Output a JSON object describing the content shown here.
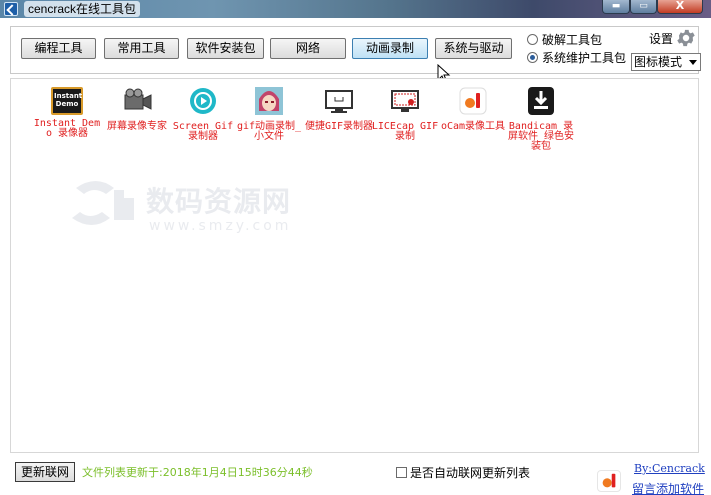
{
  "window": {
    "title": "cencrack在线工具包",
    "close_glyph": "X"
  },
  "categories": [
    {
      "label": "编程工具"
    },
    {
      "label": "常用工具"
    },
    {
      "label": "软件安装包"
    },
    {
      "label": "网络"
    },
    {
      "label": "动画录制",
      "active": true
    },
    {
      "label": "系统与驱动"
    }
  ],
  "toolkit_options": [
    {
      "label": "破解工具包",
      "checked": false
    },
    {
      "label": "系统维护工具包",
      "checked": true
    }
  ],
  "settings": {
    "label": "设置",
    "view_mode": "图标模式"
  },
  "tools": [
    {
      "label": "Instant Demo 录像器",
      "icon": "instant-demo-icon",
      "badge": "Instant Demo"
    },
    {
      "label": "屏幕录像专家",
      "icon": "video-camera-icon"
    },
    {
      "label": "Screen Gif 录制器",
      "icon": "play-circle-icon"
    },
    {
      "label": "gif动画录制_小文件",
      "icon": "anime-character-icon"
    },
    {
      "label": "便捷GIF录制器",
      "icon": "monitor-icon"
    },
    {
      "label": "LICEcap GIF 录制",
      "icon": "record-monitor-icon"
    },
    {
      "label": "oCam录像工具",
      "icon": "ocam-icon"
    },
    {
      "label": "Bandicam 录屏软件_绿色安装包",
      "icon": "download-icon"
    }
  ],
  "watermark": {
    "text": "数码资源网",
    "url": "www.smzy.com"
  },
  "status": {
    "refresh_button": "更新联网",
    "update_text": "文件列表更新于:2018年1月4日15时36分44秒",
    "auto_update_label": "是否自动联网更新列表",
    "auto_update_checked": false,
    "author_link": "By:Cencrack",
    "feedback_link": "留言添加软件"
  },
  "colors": {
    "tool_label": "#e02020",
    "update_text": "#7bbf2a",
    "link": "#2040c0"
  }
}
